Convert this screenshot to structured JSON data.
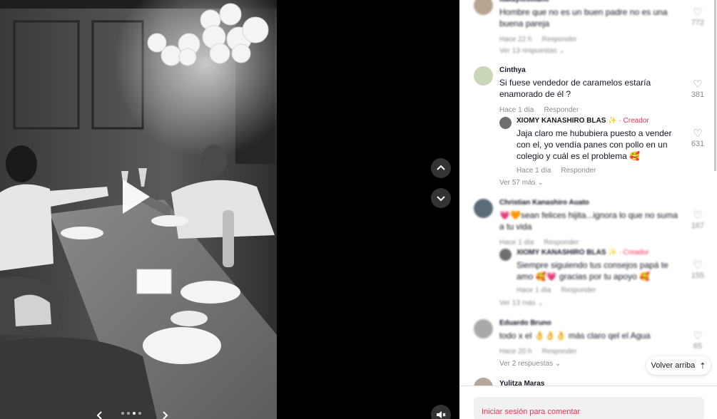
{
  "media": {
    "icons": {
      "play": "play-icon",
      "prev": "chevron-left-icon",
      "next": "chevron-right-icon",
      "up": "chevron-up-icon",
      "down": "chevron-down-icon",
      "mute": "mute-icon"
    },
    "slides_total": 4,
    "active_slide": 3
  },
  "comments": [
    {
      "username": "itakaylosolano",
      "text": "Hombre que no es un buen padre no es una buena pareja",
      "time": "Hace 22 h",
      "reply": "Responder",
      "likes": "772",
      "view_more": "Ver 13 respuestas"
    },
    {
      "username": "Cinthya",
      "text": "Si fuese vendedor de caramelos estaría enamorado de él ?",
      "time": "Hace 1 día",
      "reply": "Responder",
      "likes": "381",
      "view_more": "Ver 57 más"
    },
    {
      "username": "Christian Kanashiro Auato",
      "text": "💗🧡sean felices hijita...ignora lo que no suma a tu vida",
      "time": "Hace 1 día",
      "reply": "Responder",
      "likes": "167",
      "view_more": "Ver 13 más"
    },
    {
      "username": "Eduardo Bruno",
      "text": "todo x el 👌👌👌 más claro qel el Agua",
      "time": "Hace 20 h",
      "reply": "Responder",
      "likes": "65",
      "view_more": "Ver 2 respuestas"
    },
    {
      "username": "Yulitza Maras"
    }
  ],
  "replies": [
    {
      "username": "XIOMY KANASHIRO BLAS",
      "sparkle": "✨",
      "badge": "· Creador",
      "text": "Jaja claro me hububiera puesto a vender con el, yo vendía panes con pollo en un colegio y cuál es el problema 🥰",
      "time": "Hace 1 día",
      "reply": "Responder",
      "likes": "631"
    },
    {
      "username": "XIOMY KANASHIRO BLAS",
      "sparkle": "✨",
      "badge": "· Creador",
      "text": "Siempre siguiendo tus consejos papá te amo 🥰💗 gracias por tu apoyo 🥰",
      "time": "Hace 1 día",
      "reply": "Responder",
      "likes": "155"
    }
  ],
  "back_to_top": "Volver arriba",
  "login_prompt": "Iniciar sesión para comentar",
  "colors": {
    "accent": "#fe2c55",
    "muted_text": "#8a8b91",
    "text": "#161823"
  }
}
